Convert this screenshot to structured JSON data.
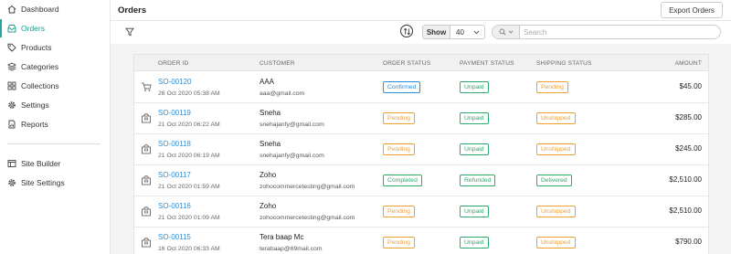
{
  "sidebar": {
    "items": [
      {
        "label": "Dashboard",
        "icon": "home-icon"
      },
      {
        "label": "Orders",
        "icon": "inbox-icon"
      },
      {
        "label": "Products",
        "icon": "tag-icon"
      },
      {
        "label": "Categories",
        "icon": "layers-icon"
      },
      {
        "label": "Collections",
        "icon": "grid-icon"
      },
      {
        "label": "Settings",
        "icon": "gear-icon"
      },
      {
        "label": "Reports",
        "icon": "report-icon"
      },
      {
        "label": "Site Builder",
        "icon": "site-builder-icon"
      },
      {
        "label": "Site Settings",
        "icon": "site-settings-icon"
      }
    ],
    "active_item": "Orders"
  },
  "header": {
    "title": "Orders",
    "export_label": "Export Orders"
  },
  "toolbar": {
    "show_label": "Show",
    "show_value": "40",
    "search_placeholder": "Search"
  },
  "table": {
    "columns": {
      "order_id": "ORDER ID",
      "customer": "CUSTOMER",
      "order_status": "ORDER STATUS",
      "payment_status": "PAYMENT STATUS",
      "shipping_status": "SHIPPING STATUS",
      "amount": "AMOUNT"
    },
    "rows": [
      {
        "id": "SO-00120",
        "date": "26 Oct 2020 05:38 AM",
        "name": "AAA",
        "email": "aaa@gmail.com",
        "order_status": "Confirmed",
        "payment_status": "Unpaid",
        "shipping_status": "Pending",
        "amount": "$45.00"
      },
      {
        "id": "SO-00119",
        "date": "21 Oct 2020 06:22 AM",
        "name": "Sneha",
        "email": "snehajanfy@gmail.com",
        "order_status": "Pending",
        "payment_status": "Unpaid",
        "shipping_status": "Unshipped",
        "amount": "$285.00"
      },
      {
        "id": "SO-00118",
        "date": "21 Oct 2020 06:19 AM",
        "name": "Sneha",
        "email": "snehajanfy@gmail.com",
        "order_status": "Pending",
        "payment_status": "Unpaid",
        "shipping_status": "Unshipped",
        "amount": "$245.00"
      },
      {
        "id": "SO-00117",
        "date": "21 Oct 2020 01:59 AM",
        "name": "Zoho",
        "email": "zohocommercetesting@gmail.com",
        "order_status": "Completed",
        "payment_status": "Refunded",
        "shipping_status": "Delivered",
        "amount": "$2,510.00"
      },
      {
        "id": "SO-00116",
        "date": "21 Oct 2020 01:09 AM",
        "name": "Zoho",
        "email": "zohocommercetesting@gmail.com",
        "order_status": "Pending",
        "payment_status": "Unpaid",
        "shipping_status": "Unshipped",
        "amount": "$2,510.00"
      },
      {
        "id": "SO-00115",
        "date": "16 Oct 2020 06:33 AM",
        "name": "Tera baap Mc",
        "email": "terabaap@69mail.com",
        "order_status": "Pending",
        "payment_status": "Unpaid",
        "shipping_status": "Unshipped",
        "amount": "$790.00"
      }
    ]
  },
  "colors": {
    "accent": "#26a69a",
    "link": "#2b8ed6",
    "status_blue": "#2b8ed6",
    "status_green": "#2eaa6b",
    "status_orange": "#f0a030"
  }
}
